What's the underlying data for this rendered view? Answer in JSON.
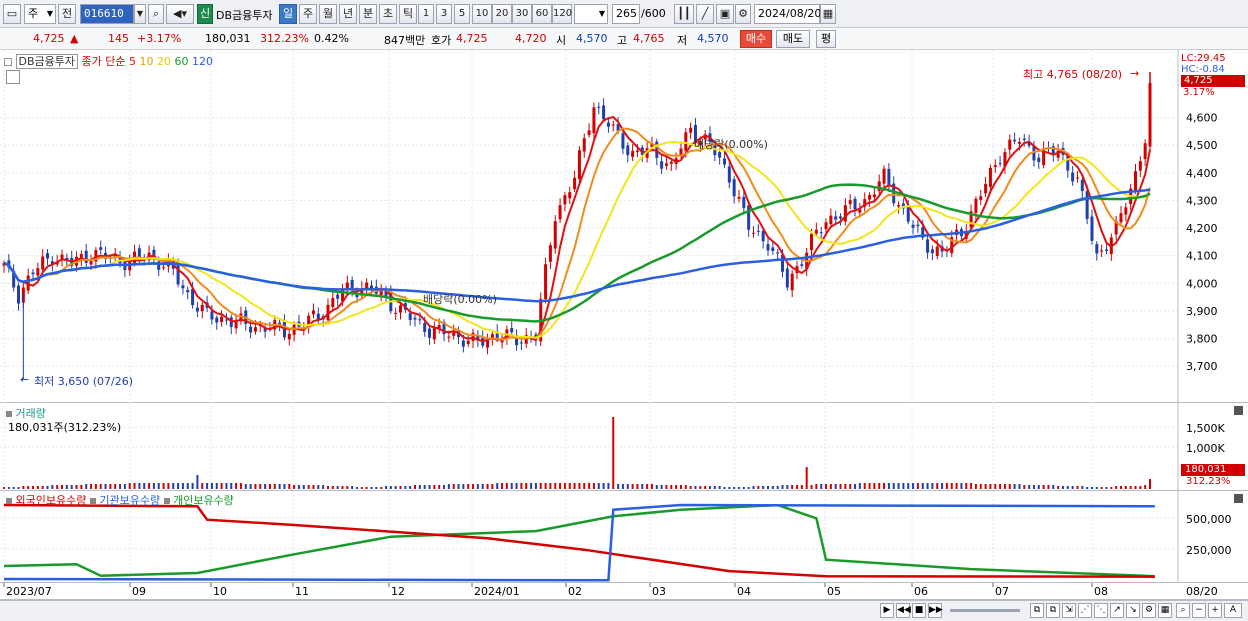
{
  "toolbar": {
    "period_select": "주",
    "all_button": "전",
    "stock_code": "016610",
    "new_badge": "신",
    "stock_name": "DB금융투자",
    "tabs": [
      "일",
      "주",
      "월",
      "년",
      "분",
      "초",
      "틱"
    ],
    "active_tab": "일",
    "interval_buttons": [
      "1",
      "3",
      "5",
      "10",
      "20",
      "30",
      "60",
      "120"
    ],
    "count_value": "265",
    "count_max": "/600",
    "date_value": "2024/08/20"
  },
  "quote": {
    "price": "4,725",
    "up_arrow": "▲",
    "change": "145",
    "change_pct": "+3.17%",
    "volume": "180,031",
    "volume_ratio": "312.23%",
    "turnover": "0.42%",
    "amount": "847백만",
    "ask_label": "호가",
    "ask": "4,725",
    "bid": "4,720",
    "open_label": "시",
    "open": "4,570",
    "high_label": "고",
    "high": "4,765",
    "low_label": "저",
    "low": "4,570",
    "buy_button": "매수",
    "sell_button": "매도",
    "eval_button": "평"
  },
  "main_chart": {
    "stock_label": "DB금융투자",
    "legend_prefix": "종가 단순",
    "ma_periods": [
      "5",
      "10",
      "20",
      "60",
      "120"
    ],
    "lc_label": "LC:29.45",
    "hc_label": "HC:-0.84",
    "current_price_tag": "4,725",
    "current_pct_tag": "3.17%",
    "high_annotation": "최고 4,765 (08/20)",
    "low_annotation": "최저 3,650 (07/26)",
    "dividend_annotation": "배당락(0.00%)",
    "right_annotation": "배당락(0.00%)",
    "y_ticks": [
      "4,600",
      "4,500",
      "4,400",
      "4,300",
      "4,200",
      "4,100",
      "4,000",
      "3,900",
      "3,800",
      "3,700"
    ],
    "colors": {
      "up": "#d20000",
      "down": "#1f3fae",
      "ma5": "#e01010",
      "ma10": "#f08c1c",
      "ma20": "#f2e51a",
      "ma60": "#1a9a2c",
      "ma120": "#2a5fe0"
    }
  },
  "volume_chart": {
    "title": "거래량",
    "value_label": "180,031주(312.23%)",
    "y_ticks": [
      "1,500K",
      "1,000K"
    ],
    "current_tag": "180,031",
    "current_pct": "312.23%"
  },
  "holding_chart": {
    "legend": [
      "외국인보유수량",
      "기관보유수량",
      "개인보유수량"
    ],
    "colors": [
      "#d20000",
      "#2a5fe0",
      "#1a9a2c"
    ],
    "y_ticks": [
      "500,000",
      "250,000"
    ]
  },
  "x_axis": {
    "labels": [
      "2023/07",
      "09",
      "10",
      "11",
      "12",
      "2024/01",
      "02",
      "03",
      "04",
      "05",
      "06",
      "07",
      "08"
    ],
    "right_label": "08/20"
  },
  "chart_data": {
    "type": "candlestick",
    "title": "DB금융투자",
    "period": "daily",
    "x_range": [
      "2023/07",
      "2024/08/20"
    ],
    "y_range_price": [
      3650,
      4765
    ],
    "price_path": [
      [
        0,
        4060
      ],
      [
        3,
        3960
      ],
      [
        6,
        4040
      ],
      [
        10,
        4100
      ],
      [
        14,
        4070
      ],
      [
        18,
        4110
      ],
      [
        22,
        4090
      ],
      [
        26,
        4080
      ],
      [
        30,
        4100
      ],
      [
        34,
        4060
      ],
      [
        38,
        3960
      ],
      [
        42,
        3880
      ],
      [
        46,
        3870
      ],
      [
        50,
        3850
      ],
      [
        54,
        3840
      ],
      [
        58,
        3830
      ],
      [
        62,
        3850
      ],
      [
        66,
        3900
      ],
      [
        70,
        3970
      ],
      [
        74,
        3990
      ],
      [
        78,
        3960
      ],
      [
        82,
        3900
      ],
      [
        86,
        3850
      ],
      [
        90,
        3820
      ],
      [
        94,
        3810
      ],
      [
        98,
        3780
      ],
      [
        102,
        3820
      ],
      [
        106,
        3790
      ],
      [
        110,
        3820
      ],
      [
        114,
        4250
      ],
      [
        118,
        4380
      ],
      [
        122,
        4650
      ],
      [
        126,
        4550
      ],
      [
        130,
        4470
      ],
      [
        134,
        4480
      ],
      [
        138,
        4420
      ],
      [
        142,
        4560
      ],
      [
        146,
        4500
      ],
      [
        150,
        4390
      ],
      [
        154,
        4200
      ],
      [
        158,
        4150
      ],
      [
        162,
        4000
      ],
      [
        166,
        4120
      ],
      [
        170,
        4230
      ],
      [
        174,
        4260
      ],
      [
        178,
        4300
      ],
      [
        182,
        4380
      ],
      [
        186,
        4260
      ],
      [
        190,
        4150
      ],
      [
        194,
        4110
      ],
      [
        198,
        4190
      ],
      [
        202,
        4320
      ],
      [
        206,
        4470
      ],
      [
        210,
        4520
      ],
      [
        214,
        4460
      ],
      [
        218,
        4480
      ],
      [
        222,
        4370
      ],
      [
        226,
        4100
      ],
      [
        230,
        4190
      ],
      [
        234,
        4400
      ],
      [
        236,
        4520
      ],
      [
        237,
        4725
      ]
    ],
    "annotations": [
      {
        "text": "최고 4,765 (08/20)",
        "value": 4765
      },
      {
        "text": "최저 3,650 (07/26)",
        "value": 3650
      }
    ],
    "volume_current": 180031
  }
}
